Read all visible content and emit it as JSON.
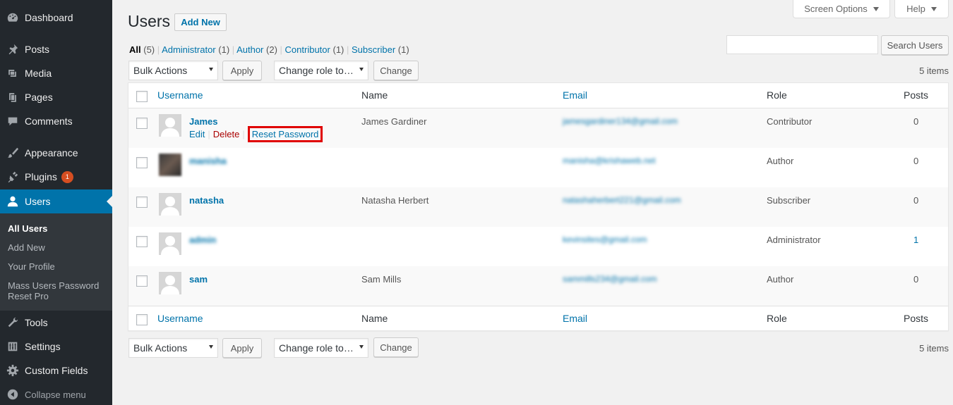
{
  "sidebar": {
    "items": [
      {
        "label": "Dashboard",
        "icon": "dashboard-icon"
      },
      {
        "label": "Posts",
        "icon": "pin-icon"
      },
      {
        "label": "Media",
        "icon": "media-icon"
      },
      {
        "label": "Pages",
        "icon": "pages-icon"
      },
      {
        "label": "Comments",
        "icon": "comment-icon"
      },
      {
        "label": "Appearance",
        "icon": "brush-icon"
      },
      {
        "label": "Plugins",
        "icon": "plugin-icon",
        "badge": "1"
      },
      {
        "label": "Users",
        "icon": "user-icon",
        "current": true
      },
      {
        "label": "Tools",
        "icon": "wrench-icon"
      },
      {
        "label": "Settings",
        "icon": "settings-icon"
      },
      {
        "label": "Custom Fields",
        "icon": "gear-icon"
      }
    ],
    "submenu": [
      "All Users",
      "Add New",
      "Your Profile",
      "Mass Users Password",
      "Reset Pro"
    ],
    "collapse_label": "Collapse menu"
  },
  "top": {
    "screen_options": "Screen Options",
    "help": "Help"
  },
  "header": {
    "title": "Users",
    "add_new": "Add New"
  },
  "filters": {
    "all": "All",
    "all_count": "(5)",
    "administrator": "Administrator",
    "administrator_count": "(1)",
    "author": "Author",
    "author_count": "(2)",
    "contributor": "Contributor",
    "contributor_count": "(1)",
    "subscriber": "Subscriber",
    "subscriber_count": "(1)",
    "separator": "|"
  },
  "search": {
    "value": "",
    "button": "Search Users"
  },
  "toolbar": {
    "bulk_actions": "Bulk Actions",
    "apply": "Apply",
    "change_role": "Change role to…",
    "change": "Change",
    "items_count": "5 items"
  },
  "table": {
    "columns": {
      "username": "Username",
      "name": "Name",
      "email": "Email",
      "role": "Role",
      "posts": "Posts"
    },
    "row_actions": {
      "edit": "Edit",
      "delete": "Delete",
      "reset_password": "Reset Password",
      "separator": "|"
    },
    "rows": [
      {
        "username": "James",
        "name": "James Gardiner",
        "email": "jamesgardiner134@gmail.com",
        "role": "Contributor",
        "posts": "0"
      },
      {
        "username": "manisha",
        "name": "",
        "email": "manisha@krishaweb.net",
        "role": "Author",
        "posts": "0"
      },
      {
        "username": "natasha",
        "name": "Natasha Herbert",
        "email": "natashaherbert221@gmail.com",
        "role": "Subscriber",
        "posts": "0"
      },
      {
        "username": "admin",
        "name": "",
        "email": "kevinsites@gmail.com",
        "role": "Administrator",
        "posts": "1"
      },
      {
        "username": "sam",
        "name": "Sam Mills",
        "email": "sammills234@gmail.com",
        "role": "Author",
        "posts": "0"
      }
    ]
  },
  "colors": {
    "sidebar_bg": "#23282d",
    "accent": "#0073aa",
    "highlight": "#e00000"
  }
}
